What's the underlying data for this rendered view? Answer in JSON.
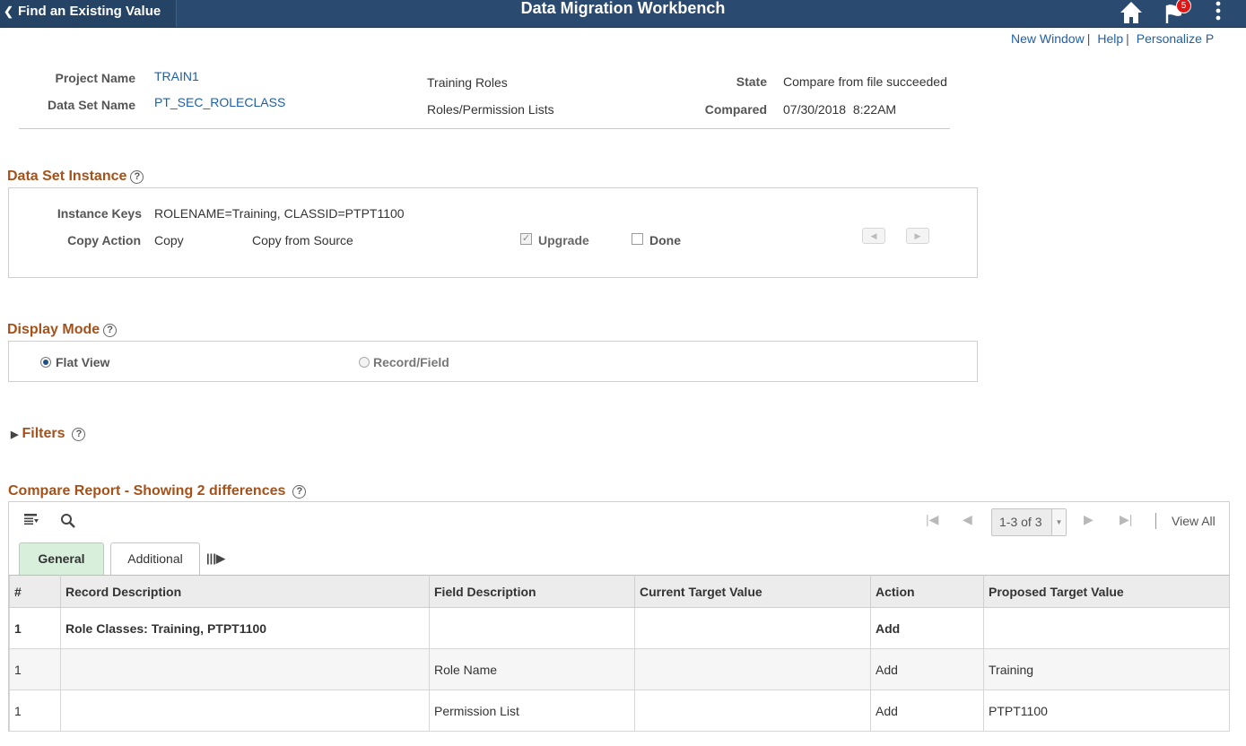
{
  "header": {
    "back_label": "Find an Existing Value",
    "title": "Data Migration Workbench",
    "notification_count": "5",
    "icons": {
      "back": "chevron-left-icon",
      "home": "home-icon",
      "notifications": "flag-icon",
      "menu": "kebab-menu-icon"
    },
    "bar_color": "#2a4a6f"
  },
  "top_links": {
    "new_window": "New Window",
    "help": "Help",
    "personalize": "Personalize P"
  },
  "summary": {
    "project_name_label": "Project Name",
    "project_name": "TRAIN1",
    "data_set_label": "Data Set Name",
    "data_set": "PT_SEC_ROLECLASS",
    "project_description": "Training Roles",
    "data_set_description": "Roles/Permission Lists",
    "state_label": "State",
    "state": "Compare from file succeeded",
    "compared_label": "Compared",
    "compared": "07/30/2018  8:22AM"
  },
  "data_set_instance": {
    "title": "Data Set Instance",
    "instance_keys_label": "Instance Keys",
    "instance_keys": "ROLENAME=Training, CLASSID=PTPT1100",
    "copy_action_label": "Copy Action",
    "copy_action": "Copy",
    "copy_source": "Copy from Source",
    "upgrade_label": "Upgrade",
    "upgrade_checked": true,
    "done_label": "Done",
    "done_checked": false
  },
  "display_mode": {
    "title": "Display Mode",
    "options": [
      {
        "label": "Flat View",
        "selected": true
      },
      {
        "label": "Record/Field",
        "selected": false
      }
    ]
  },
  "filters": {
    "title": "Filters"
  },
  "compare_report": {
    "title": "Compare Report - Showing 2 differences",
    "pager_value": "1-3 of 3",
    "view_all": "View All",
    "tabs": [
      {
        "label": "General",
        "active": true
      },
      {
        "label": "Additional",
        "active": false
      }
    ],
    "columns": [
      "#",
      "Record Description",
      "Field Description",
      "Current Target Value",
      "Action",
      "Proposed Target Value"
    ],
    "rows": [
      [
        "1",
        "Role Classes: Training, PTPT1100",
        "",
        "",
        "Add",
        ""
      ],
      [
        "1",
        "",
        "Role Name",
        "",
        "Add",
        "Training"
      ],
      [
        "1",
        "",
        "Permission List",
        "",
        "Add",
        "PTPT1100"
      ]
    ]
  },
  "colors": {
    "section_title": "#a6511a",
    "link": "#1f5fa8",
    "active_tab": "#d8efdb"
  }
}
